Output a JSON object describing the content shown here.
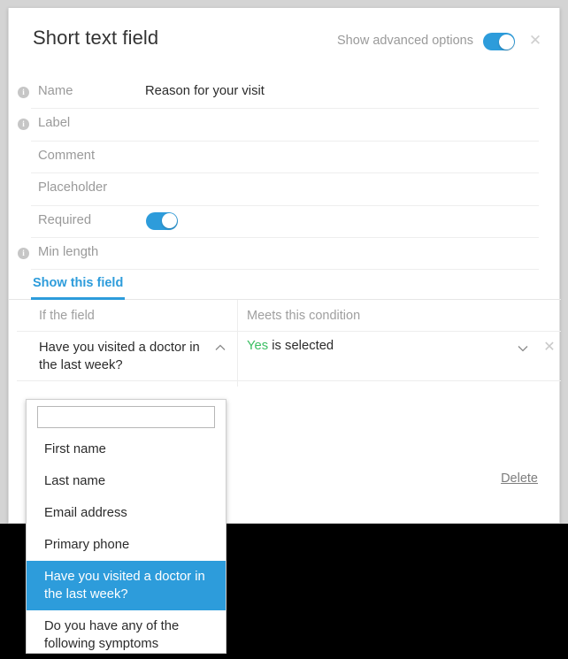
{
  "dialog": {
    "title": "Short text field",
    "advanced_options_label": "Show advanced options",
    "advanced_options_on": true,
    "close_icon": "close-icon",
    "accent_color": "#2d9cdb",
    "delete_label": "Delete"
  },
  "fields": [
    {
      "label": "Name",
      "value": "Reason for your visit",
      "has_info": true,
      "control": "text"
    },
    {
      "label": "Label",
      "value": "",
      "has_info": true,
      "control": "text"
    },
    {
      "label": "Comment",
      "value": "",
      "has_info": false,
      "control": "text"
    },
    {
      "label": "Placeholder",
      "value": "",
      "has_info": false,
      "control": "text"
    },
    {
      "label": "Required",
      "value": "",
      "has_info": false,
      "control": "toggle",
      "toggle_on": true
    },
    {
      "label": "Min length",
      "value": "",
      "has_info": true,
      "control": "text"
    }
  ],
  "tabs": [
    {
      "label": "Show this field",
      "active": true
    }
  ],
  "condition_table": {
    "headers": {
      "field": "If the field",
      "condition": "Meets this condition"
    },
    "row": {
      "field_value": "Have you visited a doctor in the last week?",
      "condition_value_highlight": "Yes",
      "condition_value_rest": " is selected",
      "highlight_color": "#3bbf63"
    }
  },
  "dropdown": {
    "open": true,
    "search_value": "",
    "search_placeholder": "",
    "options": [
      {
        "label": "First name",
        "selected": false
      },
      {
        "label": "Last name",
        "selected": false
      },
      {
        "label": "Email address",
        "selected": false
      },
      {
        "label": "Primary phone",
        "selected": false
      },
      {
        "label": "Have you visited a doctor in the last week?",
        "selected": true
      },
      {
        "label": "Do you have any of the following symptoms",
        "selected": false
      }
    ]
  }
}
